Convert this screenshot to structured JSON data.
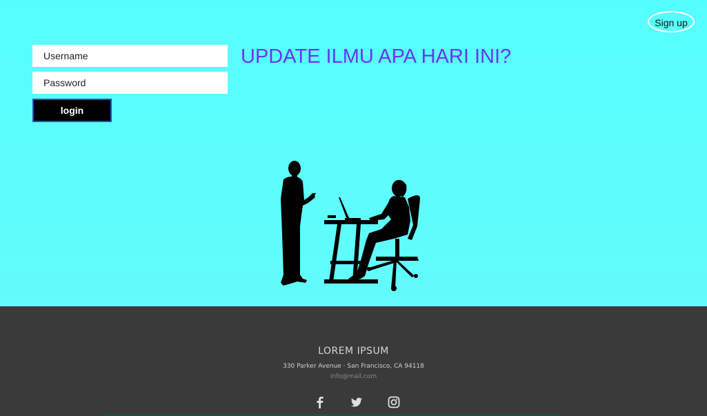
{
  "header": {
    "signup_label": "Sign up"
  },
  "login_form": {
    "username_placeholder": "Username",
    "password_placeholder": "Password",
    "login_label": "login"
  },
  "hero": {
    "headline": "UPDATE ILMU APA HARI INI?",
    "illustration": "people-meeting-silhouette"
  },
  "footer": {
    "title": "LOREM IPSUM",
    "address": "330 Parker Avenue · San Francisco, CA 94118",
    "email": "info@mail.com",
    "social_icons": [
      "facebook-icon",
      "twitter-icon",
      "instagram-icon"
    ]
  },
  "colors": {
    "hero_background": "#55fefe",
    "headline": "#6a36f0",
    "footer_background": "#3a3a3a",
    "login_button": "#000000",
    "login_border": "#1f4fd6"
  }
}
